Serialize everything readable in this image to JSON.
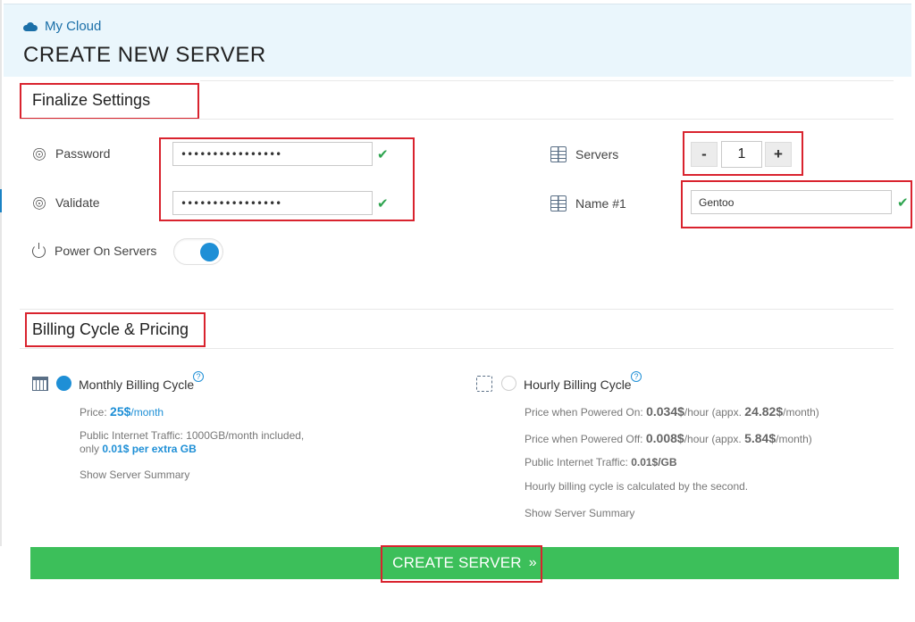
{
  "header": {
    "breadcrumb": "My Cloud",
    "title": "CREATE NEW SERVER"
  },
  "finalize": {
    "section_title": "Finalize Settings",
    "password_label": "Password",
    "password_value": "••••••••••••••••",
    "validate_label": "Validate",
    "validate_value": "••••••••••••••••",
    "power_label": "Power On Servers",
    "power_on": true,
    "servers_label": "Servers",
    "servers_minus": "-",
    "servers_value": "1",
    "servers_plus": "+",
    "name_label": "Name #1",
    "name_value": "Gentoo",
    "check_mark": "✔"
  },
  "billing": {
    "section_title": "Billing Cycle & Pricing",
    "help_glyph": "?",
    "monthly": {
      "title": "Monthly Billing Cycle",
      "selected": true,
      "price_label": "Price:",
      "price_value": "25$",
      "price_unit": "/month",
      "traffic_line1": "Public Internet Traffic: 1000GB/month included,",
      "traffic_line2_prefix": "only",
      "traffic_line2_value": "0.01$ per extra GB",
      "summary_link": "Show Server Summary"
    },
    "hourly": {
      "title": "Hourly Billing Cycle",
      "selected": false,
      "on_label": "Price when Powered On:",
      "on_value": "0.034$",
      "on_unit": "/hour (appx.",
      "on_month_value": "24.82$",
      "on_month_unit": "/month)",
      "off_label": "Price when Powered Off:",
      "off_value": "0.008$",
      "off_unit": "/hour (appx.",
      "off_month_value": "5.84$",
      "off_month_unit": "/month)",
      "traffic_label": "Public Internet Traffic:",
      "traffic_value": "0.01$/GB",
      "note": "Hourly billing cycle is calculated by the second.",
      "summary_link": "Show Server Summary"
    }
  },
  "actions": {
    "create_label": "CREATE SERVER",
    "create_chevron": "»"
  },
  "colors": {
    "accent": "#1e8fd6",
    "create_button": "#3cbf5a",
    "annotation_box": "#d9232e",
    "header_bg": "#eaf6fc",
    "valid_check": "#2ea44f"
  }
}
